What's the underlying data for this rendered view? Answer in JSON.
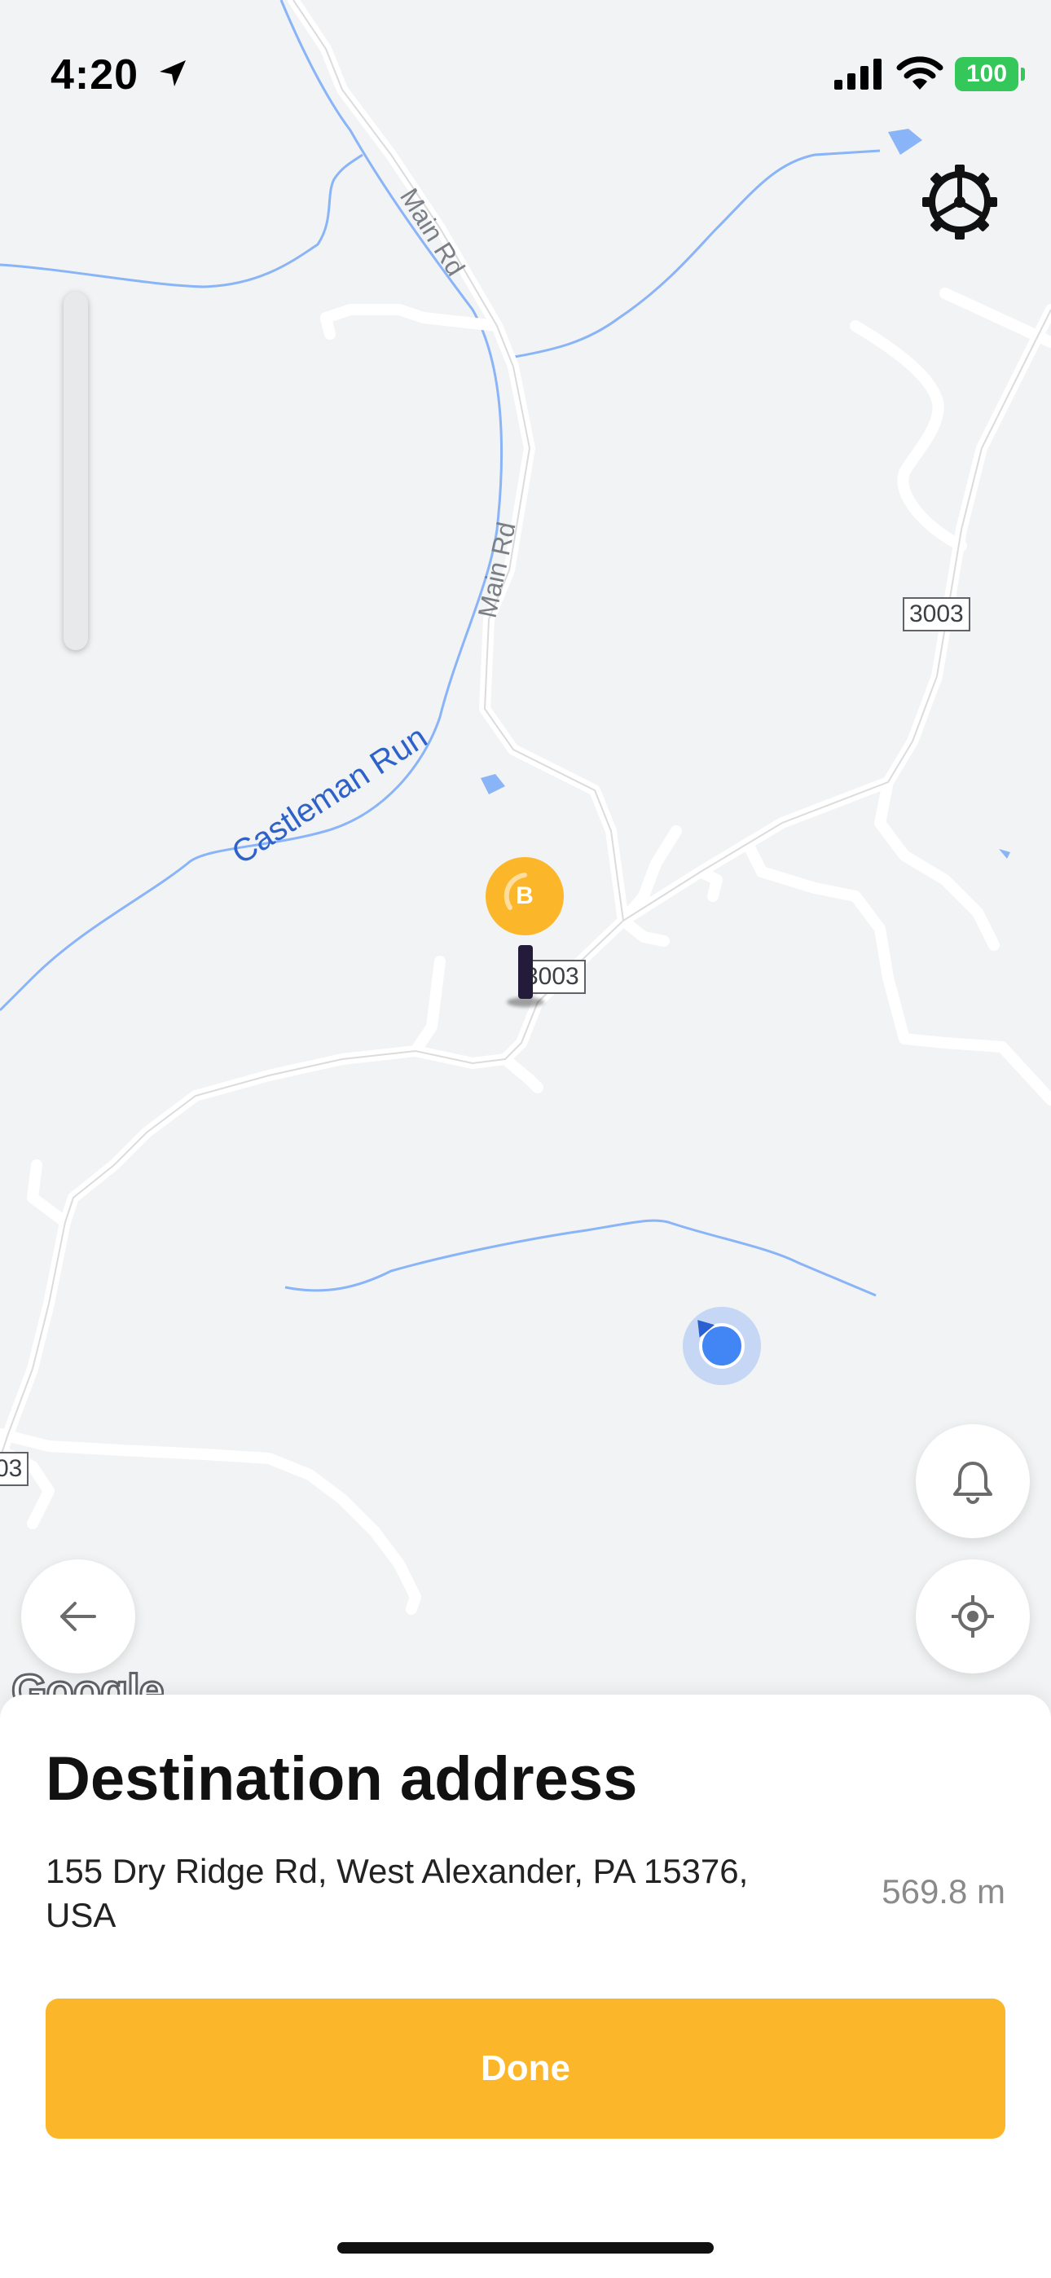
{
  "status_bar": {
    "time": "4:20",
    "battery": "100"
  },
  "map": {
    "road_labels": [
      "Main Rd",
      "Main Rd"
    ],
    "river_label": "Castleman Run",
    "route_shields": [
      "3003",
      "3003",
      "03"
    ],
    "destination_marker_label": "B",
    "attribution": "Google"
  },
  "icons": {
    "settings": "gear-icon",
    "alerts": "bell-icon",
    "locate": "crosshair-icon",
    "back": "arrow-left-icon"
  },
  "sheet": {
    "title": "Destination address",
    "address": "155 Dry Ridge Rd, West Alexander, PA 15376, USA",
    "distance": "569.8 m",
    "done_label": "Done"
  },
  "colors": {
    "accent": "#fbb62a",
    "user_location": "#4285f4",
    "water": "#8ab4f8",
    "battery": "#34c759"
  }
}
